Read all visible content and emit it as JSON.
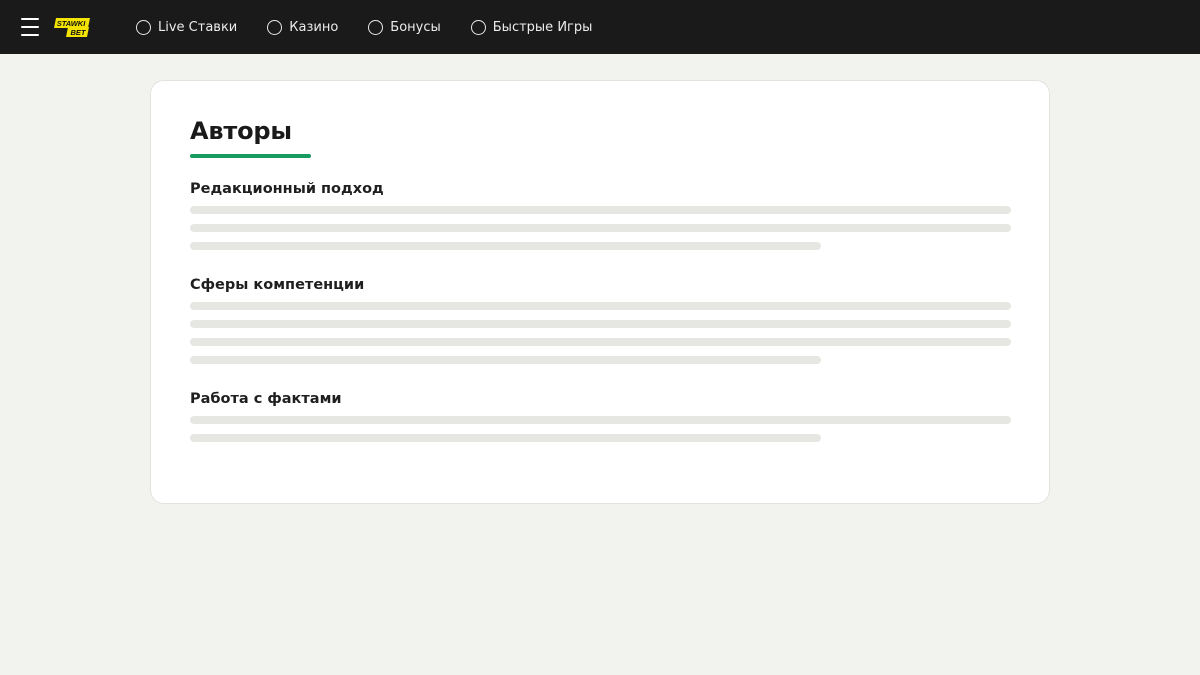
{
  "header": {
    "menu_icon": "hamburger-menu-icon",
    "logo": {
      "line1": "STAWKI",
      "line2": "BET",
      "accent_color": "#f5e400"
    },
    "nav": [
      {
        "label": "Live Ставки",
        "icon": "circle-icon"
      },
      {
        "label": "Казино",
        "icon": "circle-icon"
      },
      {
        "label": "Бонусы",
        "icon": "circle-icon"
      },
      {
        "label": "Быстрые Игры",
        "icon": "circle-icon"
      }
    ],
    "background_color": "#1a1a1a"
  },
  "main": {
    "title": "Авторы",
    "accent_color": "#169b61",
    "sections": [
      {
        "title": "Редакционный подход",
        "placeholder_lines": 3
      },
      {
        "title": "Сферы компетенции",
        "placeholder_lines": 4
      },
      {
        "title": "Работа с фактами",
        "placeholder_lines": 2
      }
    ]
  }
}
